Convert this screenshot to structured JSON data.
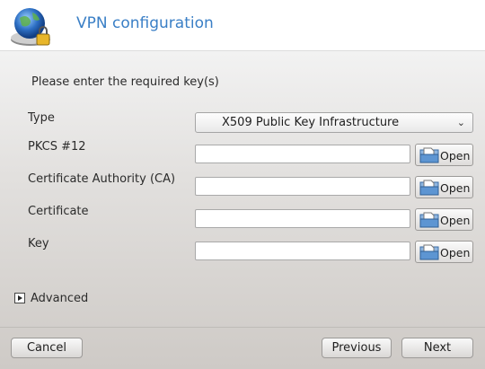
{
  "header": {
    "title": "VPN configuration",
    "logo_icon": "vpn-globe-lock-icon"
  },
  "instruction": "Please enter the required key(s)",
  "form": {
    "type_label": "Type",
    "type_value": "X509 Public Key Infrastructure",
    "pkcs_label": "PKCS #12",
    "pkcs_value": "",
    "ca_label": "Certificate Authority (CA)",
    "ca_value": "",
    "cert_label": "Certificate",
    "cert_value": "",
    "key_label": "Key",
    "key_value": "",
    "open_label": "Open",
    "open_icon": "folder-open-icon"
  },
  "advanced": {
    "label": "Advanced",
    "icon": "expander-arrow-icon"
  },
  "footer": {
    "cancel_label": "Cancel",
    "previous_label": "Previous",
    "next_label": "Next"
  },
  "colors": {
    "title": "#3a7fc6",
    "background_top": "#f2f2f2",
    "background_bottom": "#cecac6"
  }
}
